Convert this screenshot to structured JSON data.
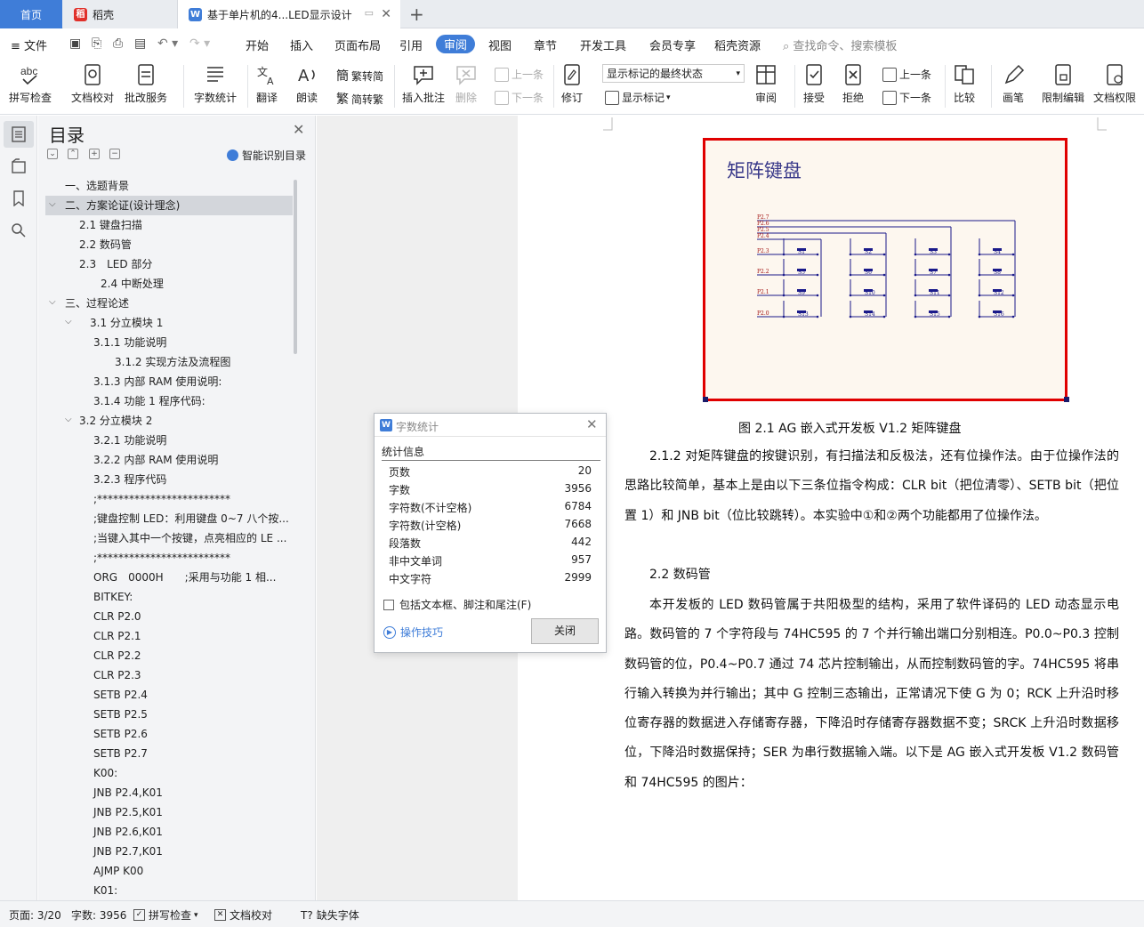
{
  "tabs": {
    "home": "首页",
    "daoke": "稻壳",
    "doc": "基于单片机的4...LED显示设计"
  },
  "menu": {
    "file": "文件",
    "items": [
      "开始",
      "插入",
      "页面布局",
      "引用",
      "审阅",
      "视图",
      "章节",
      "开发工具",
      "会员专享",
      "稻壳资源"
    ],
    "search_placeholder": "查找命令、搜索模板"
  },
  "toolbar": {
    "spell": "拼写检查",
    "doccheck": "文档校对",
    "batch": "批改服务",
    "wordcount": "字数统计",
    "translate": "翻译",
    "read": "朗读",
    "to_trad": "繁转简",
    "to_simp": "简转繁",
    "insert_comment": "插入批注",
    "delete": "删除",
    "prev": "上一条",
    "next": "下一条",
    "revise": "修订",
    "markup_state": "显示标记的最终状态",
    "show_markup": "显示标记",
    "review": "审阅",
    "accept": "接受",
    "reject": "拒绝",
    "prev2": "上一条",
    "next2": "下一条",
    "compare": "比较",
    "pen": "画笔",
    "restrict": "限制编辑",
    "doc_perm": "文档权限"
  },
  "nav": {
    "title": "目录",
    "smart": "智能识别目录",
    "items": [
      "一、选题背景",
      "二、方案论证(设计理念)",
      "2.1 键盘扫描",
      "2.2 数码管",
      "2.3　LED 部分",
      "2.4 中断处理",
      "三、过程论述",
      "3.1 分立模块 1",
      "3.1.1 功能说明",
      "3.1.2 实现方法及流程图",
      "3.1.3 内部 RAM 使用说明:",
      "3.1.4 功能 1 程序代码:",
      "3.2 分立模块 2",
      "3.2.1 功能说明",
      "3.2.2 内部 RAM 使用说明",
      "3.2.3 程序代码",
      ";*************************",
      ";键盘控制 LED：利用键盘 0~7 八个按...",
      ";当键入其中一个按键，点亮相应的 LE ...",
      ";*************************",
      "ORG　0000H　　;采用与功能 1 相...",
      "BITKEY:",
      "CLR P2.0",
      "CLR P2.1",
      "CLR P2.2",
      "CLR P2.3",
      "SETB P2.4",
      "SETB P2.5",
      "SETB P2.6",
      "SETB P2.7",
      "K00:",
      "JNB P2.4,K01",
      "JNB P2.5,K01",
      "JNB P2.6,K01",
      "JNB P2.7,K01",
      "AJMP K00",
      "K01:"
    ]
  },
  "figure": {
    "title": "矩阵键盘",
    "row_labels": [
      "P2.7",
      "P2.6",
      "P2.5",
      "P2.4",
      "P2.3",
      "P2.2",
      "P2.1",
      "P2.0"
    ],
    "keys": [
      "S1",
      "S2",
      "S3",
      "S4",
      "S5",
      "S6",
      "S7",
      "S8",
      "S9",
      "S10",
      "S11",
      "S12",
      "S13",
      "S14",
      "S15",
      "S16"
    ],
    "caption": "图 2.1 AG 嵌入式开发板 V1.2 矩阵键盘"
  },
  "doc": {
    "p1": "2.1.2 对矩阵键盘的按键识别，有扫描法和反极法，还有位操作法。由于位操作法的思路比较简单，基本上是由以下三条位指令构成：CLR bit（把位清零）、SETB bit（把位置 1）和 JNB bit（位比较跳转）。本实验中①和②两个功能都用了位操作法。",
    "h2": "2.2 数码管",
    "p2": "本开发板的 LED 数码管属于共阳极型的结构，采用了软件译码的 LED 动态显示电路。数码管的 7 个字符段与 74HC595 的 7 个并行输出端口分别相连。P0.0~P0.3 控制数码管的位，P0.4~P0.7 通过 74 芯片控制输出，从而控制数码管的字。74HC595 将串行输入转换为并行输出；其中 G 控制三态输出，正常请况下使 G 为 0；RCK 上升沿时移位寄存器的数据进入存储寄存器，下降沿时存储寄存器数据不变；SRCK 上升沿时数据移位，下降沿时数据保持；SER 为串行数据输入端。以下是 AG 嵌入式开发板 V1.2 数码管和 74HC595 的图片："
  },
  "dialog": {
    "title": "字数统计",
    "section": "统计信息",
    "rows": [
      {
        "label": "页数",
        "value": "20"
      },
      {
        "label": "字数",
        "value": "3956"
      },
      {
        "label": "字符数(不计空格)",
        "value": "6784"
      },
      {
        "label": "字符数(计空格)",
        "value": "7668"
      },
      {
        "label": "段落数",
        "value": "442"
      },
      {
        "label": "非中文单词",
        "value": "957"
      },
      {
        "label": "中文字符",
        "value": "2999"
      }
    ],
    "checkbox": "包括文本框、脚注和尾注(F)",
    "tips": "操作技巧",
    "close": "关闭"
  },
  "status": {
    "page": "页面: 3/20",
    "words": "字数: 3956",
    "spell": "拼写检查",
    "doccheck": "文档校对",
    "missing_font": "缺失字体"
  },
  "colors": {
    "accent": "#3f7dd8",
    "figure_border": "#e00000"
  }
}
